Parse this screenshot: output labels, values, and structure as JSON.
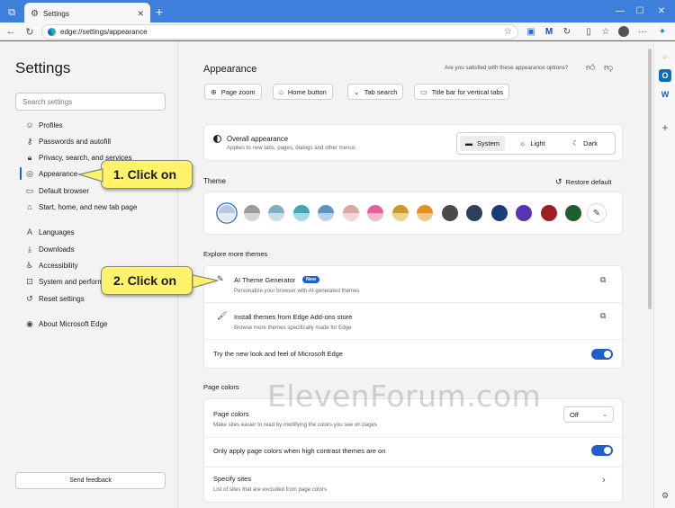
{
  "browser": {
    "tab_title": "Settings",
    "address": "edge://settings/appearance"
  },
  "sidebar": {
    "title": "Settings",
    "search_placeholder": "Search settings",
    "items": [
      {
        "label": "Profiles",
        "icon": "person-icon"
      },
      {
        "label": "Passwords and autofill",
        "icon": "key-icon"
      },
      {
        "label": "Privacy, search, and services",
        "icon": "lock-icon"
      },
      {
        "label": "Appearance",
        "icon": "appearance-icon",
        "active": true
      },
      {
        "label": "Default browser",
        "icon": "browser-icon"
      },
      {
        "label": "Start, home, and new tab page",
        "icon": "home-icon"
      },
      {
        "label": "Languages",
        "icon": "languages-icon"
      },
      {
        "label": "Downloads",
        "icon": "download-icon"
      },
      {
        "label": "Accessibility",
        "icon": "accessibility-icon"
      },
      {
        "label": "System and performance",
        "icon": "system-icon"
      },
      {
        "label": "Reset settings",
        "icon": "reset-icon"
      },
      {
        "label": "About Microsoft Edge",
        "icon": "edge-icon"
      }
    ],
    "feedback": "Send feedback"
  },
  "main": {
    "heading": "Appearance",
    "question": "Are you satisfied with these appearance options?",
    "quick_buttons": [
      "Page zoom",
      "Home button",
      "Tab search",
      "Title bar for vertical tabs"
    ],
    "overall": {
      "title": "Overall appearance",
      "desc": "Applies to new tabs, pages, dialogs and other menus",
      "options": [
        "System",
        "Light",
        "Dark"
      ],
      "selected": "System"
    },
    "theme": {
      "heading": "Theme",
      "restore": "Restore default",
      "swatches": [
        {
          "top": "#b9c6e0",
          "bottom": "#e3e9f5",
          "selected": true
        },
        {
          "top": "#9b9b9b",
          "bottom": "#d4d4d4"
        },
        {
          "top": "#7fb0bd",
          "bottom": "#c9dde2"
        },
        {
          "top": "#3ea8b2",
          "bottom": "#a6d9dd"
        },
        {
          "top": "#5f93c2",
          "bottom": "#b9d1e8"
        },
        {
          "top": "#d8a7a2",
          "bottom": "#f0d7d4"
        },
        {
          "top": "#e5609a",
          "bottom": "#f4b6d0"
        },
        {
          "top": "#c89c2c",
          "bottom": "#ead28f"
        },
        {
          "top": "#e28f23",
          "bottom": "#f3c78a"
        },
        {
          "top": "#4a4a4a",
          "bottom": "#4a4a4a"
        },
        {
          "top": "#2e3f5c",
          "bottom": "#2e3f5c"
        },
        {
          "top": "#183d78",
          "bottom": "#183d78"
        },
        {
          "top": "#5b34b3",
          "bottom": "#5b34b3"
        },
        {
          "top": "#9d1c25",
          "bottom": "#9d1c25"
        },
        {
          "top": "#1f5c2e",
          "bottom": "#1f5c2e"
        }
      ]
    },
    "explore": {
      "heading": "Explore more themes",
      "ai_title": "AI Theme Generator",
      "ai_badge": "New",
      "ai_desc": "Personalize your browser with AI-generated themes",
      "addons_title": "Install themes from Edge Add-ons store",
      "addons_desc": "Browse more themes specifically made for Edge",
      "newlook": "Try the new look and feel of Microsoft Edge"
    },
    "page_colors": {
      "heading": "Page colors",
      "title": "Page colors",
      "desc": "Make sites easier to read by modifying the colors you see on pages",
      "value": "Off",
      "high_contrast": "Only apply page colors when high contrast themes are on",
      "specify": "Specify sites",
      "specify_desc": "List of sites that are excluded from page colors"
    }
  },
  "callouts": {
    "one": "1. Click on",
    "two": "2. Click on"
  },
  "watermark": "ElevenForum.com"
}
